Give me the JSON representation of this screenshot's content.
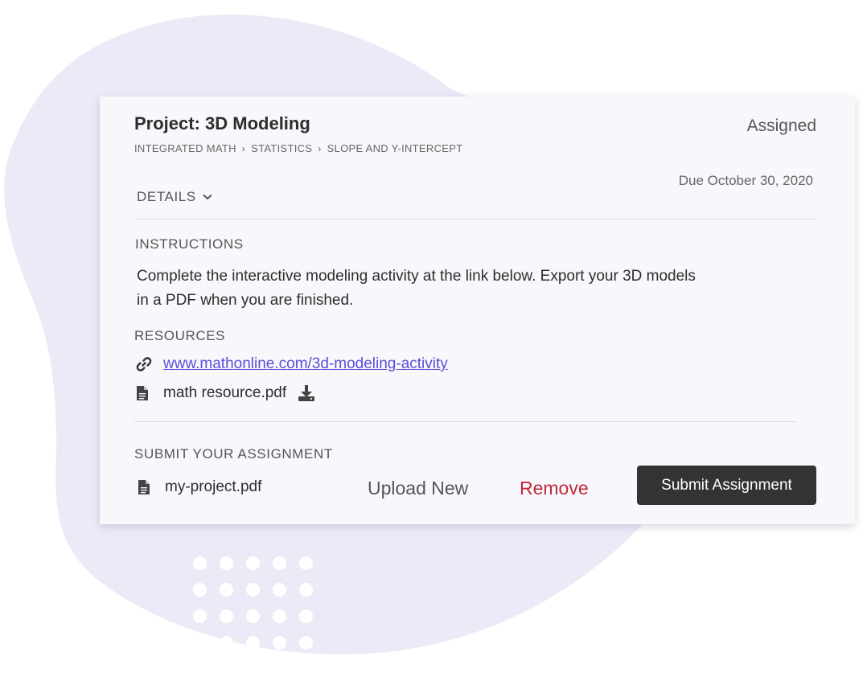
{
  "assignment": {
    "title": "Project: 3D Modeling",
    "status": "Assigned",
    "breadcrumb": [
      "INTEGRATED MATH",
      "STATISTICS",
      "SLOPE AND Y-INTERCEPT"
    ],
    "due": "Due October 30, 2020",
    "details_label": "DETAILS"
  },
  "instructions": {
    "label": "INSTRUCTIONS",
    "text": "Complete the interactive modeling activity at the link below. Export your 3D models in a PDF when you are finished."
  },
  "resources": {
    "label": "RESOURCES",
    "link": "www.mathonline.com/3d-modeling-activity",
    "file": "math resource.pdf"
  },
  "submission": {
    "label": "SUBMIT YOUR ASSIGNMENT",
    "file": "my-project.pdf",
    "upload_label": "Upload New",
    "remove_label": "Remove",
    "submit_label": "Submit Assignment"
  },
  "colors": {
    "card_bg": "#f8f8fc",
    "blob": "#ebebf8",
    "link": "#5a4fd6",
    "remove": "#c0293a",
    "button": "#333333"
  },
  "icons": {
    "details": "chevron-down-icon",
    "link": "link-icon",
    "file": "document-icon",
    "download": "download-icon"
  }
}
